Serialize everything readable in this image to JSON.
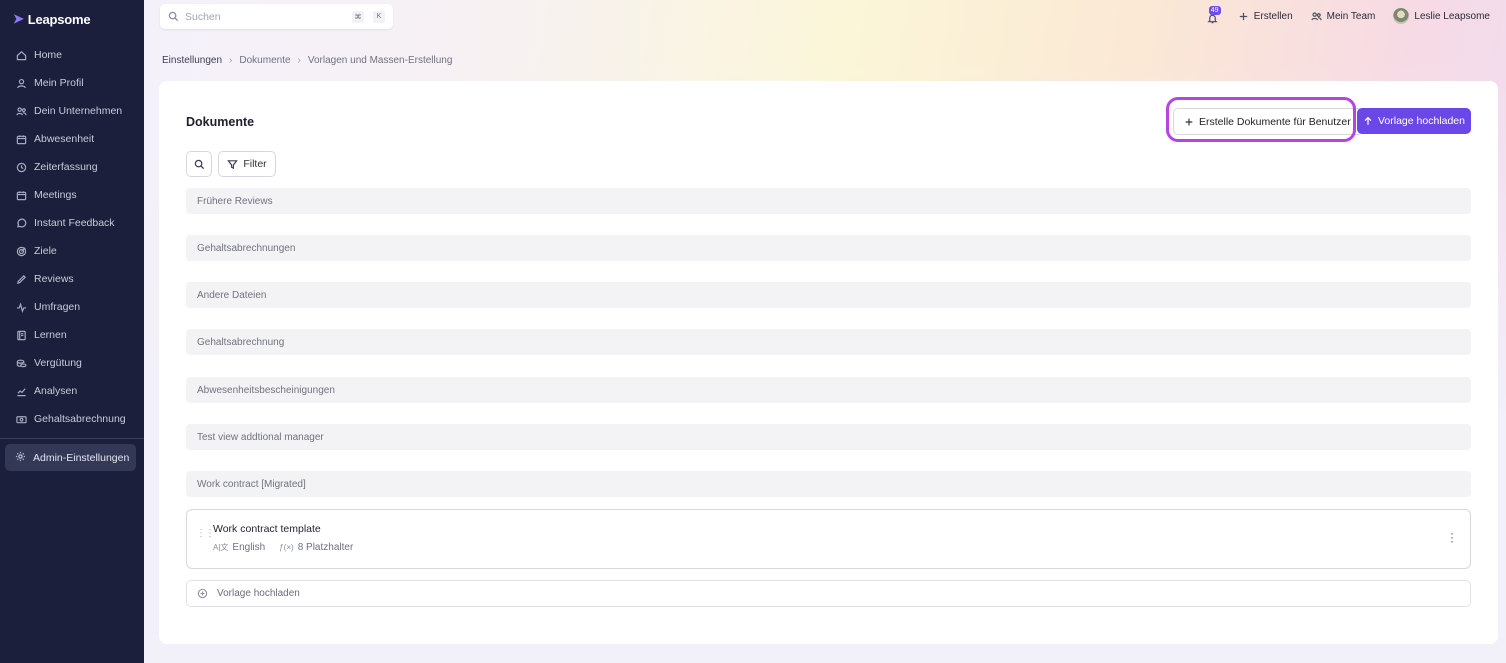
{
  "app": {
    "name": "Leapsome"
  },
  "sidebar": {
    "items": [
      {
        "label": "Home",
        "icon": "home-icon"
      },
      {
        "label": "Mein Profil",
        "icon": "user-icon"
      },
      {
        "label": "Dein Unternehmen",
        "icon": "people-icon"
      },
      {
        "label": "Abwesenheit",
        "icon": "calendar-icon"
      },
      {
        "label": "Zeiterfassung",
        "icon": "clock-icon"
      },
      {
        "label": "Meetings",
        "icon": "calendar-icon"
      },
      {
        "label": "Instant Feedback",
        "icon": "chat-icon"
      },
      {
        "label": "Ziele",
        "icon": "target-icon"
      },
      {
        "label": "Reviews",
        "icon": "pencil-icon"
      },
      {
        "label": "Umfragen",
        "icon": "pulse-icon"
      },
      {
        "label": "Lernen",
        "icon": "book-icon"
      },
      {
        "label": "Vergütung",
        "icon": "coins-icon"
      },
      {
        "label": "Analysen",
        "icon": "chart-icon"
      },
      {
        "label": "Gehaltsabrechnung",
        "icon": "money-icon"
      }
    ],
    "admin": {
      "label": "Admin-Einstellungen",
      "icon": "gear-icon"
    }
  },
  "search": {
    "placeholder": "Suchen",
    "shortcut_mod": "⌘",
    "shortcut_key": "K"
  },
  "topbar": {
    "notification_count": "49",
    "create_label": "Erstellen",
    "team_label": "Mein Team",
    "user_name": "Leslie Leapsome"
  },
  "breadcrumb": [
    "Einstellungen",
    "Dokumente",
    "Vorlagen und Massen-Erstellung"
  ],
  "card": {
    "title": "Dokumente",
    "create_button": "Erstelle Dokumente für Benutzer",
    "upload_button": "Vorlage hochladen",
    "filter_label": "Filter"
  },
  "groups": [
    "Frühere Reviews",
    "Gehaltsabrechnungen",
    "Andere Dateien",
    "Gehaltsabrechnung",
    "Abwesenheitsbescheinigungen",
    "Test view addtional manager",
    "Work contract [Migrated]"
  ],
  "template": {
    "name": "Work contract template",
    "language": "English",
    "placeholders": "8 Platzhalter"
  },
  "upload_row_label": "Vorlage hochladen",
  "colors": {
    "accent": "#6a47e6",
    "highlight": "#b743e1",
    "sidebar": "#1b1f3b"
  }
}
